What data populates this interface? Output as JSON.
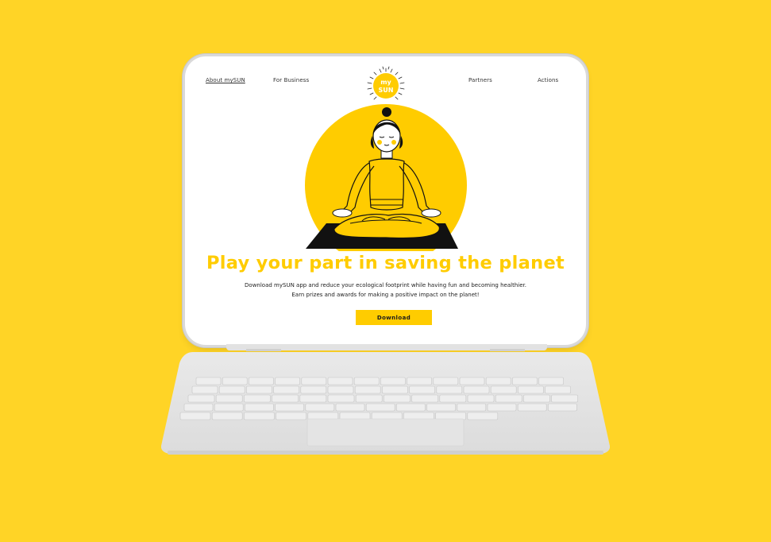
{
  "nav": {
    "about": "About mySUN",
    "business": "For Business",
    "partners": "Partners",
    "actions": "Actions"
  },
  "logo": {
    "line1": "my",
    "line2": "SUN"
  },
  "hero": {
    "headline": "Play your part in saving the planet",
    "subtext": "Download mySUN app and reduce your ecological footprint while having fun and becoming healthier. Earn prizes and awards for making a positive impact on the planet!",
    "cta": "Download"
  },
  "colors": {
    "background": "#FFD426",
    "accent": "#FFCC00",
    "text": "#222222",
    "button_text": "#1A1A1A"
  },
  "icons": {
    "logo": "sun-icon",
    "illustration": "meditating-woman-illustration",
    "keyboard": "keyboard-icon"
  }
}
